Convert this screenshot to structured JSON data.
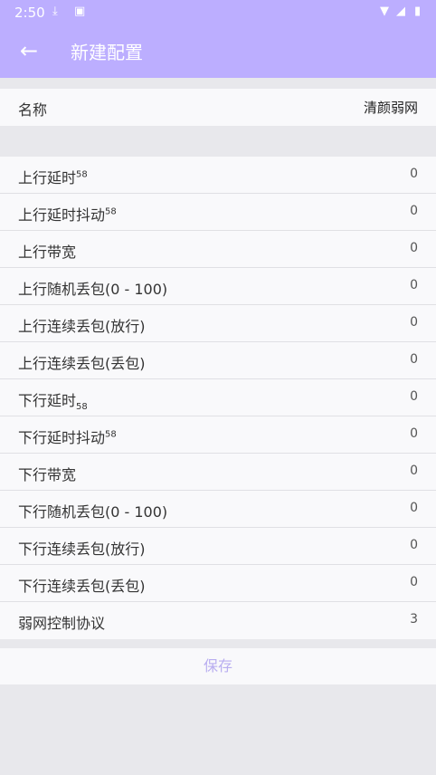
{
  "status_bar": {
    "time": "2:50"
  },
  "toolbar": {
    "title": "新建配置"
  },
  "name_row": {
    "label": "名称",
    "value": "清颜弱网"
  },
  "fields": [
    {
      "label": "上行延时",
      "unit": "58",
      "unit_pos": "sup",
      "value": "0"
    },
    {
      "label": "上行延时抖动",
      "unit": "58",
      "unit_pos": "sup",
      "value": "0"
    },
    {
      "label": "上行带宽",
      "unit": "",
      "unit_pos": "",
      "value": "0"
    },
    {
      "label": "上行随机丢包(0 - 100)",
      "unit": "",
      "unit_pos": "",
      "value": "0"
    },
    {
      "label": "上行连续丢包(放行)",
      "unit": "",
      "unit_pos": "",
      "value": "0"
    },
    {
      "label": "上行连续丢包(丢包)",
      "unit": "",
      "unit_pos": "",
      "value": "0"
    },
    {
      "label": "下行延时",
      "unit": "58",
      "unit_pos": "sub",
      "value": "0"
    },
    {
      "label": "下行延时抖动",
      "unit": "58",
      "unit_pos": "sup",
      "value": "0"
    },
    {
      "label": "下行带宽",
      "unit": "",
      "unit_pos": "",
      "value": "0"
    },
    {
      "label": "下行随机丢包(0 - 100)",
      "unit": "",
      "unit_pos": "",
      "value": "0"
    },
    {
      "label": "下行连续丢包(放行)",
      "unit": "",
      "unit_pos": "",
      "value": "0"
    },
    {
      "label": "下行连续丢包(丢包)",
      "unit": "",
      "unit_pos": "",
      "value": "0"
    },
    {
      "label": "弱网控制协议",
      "unit": "",
      "unit_pos": "",
      "value": "3"
    }
  ],
  "save_label": "保存",
  "colors": {
    "accent": "#bcaeff",
    "save_text": "#b9aef0",
    "background": "#e8e8ec"
  }
}
